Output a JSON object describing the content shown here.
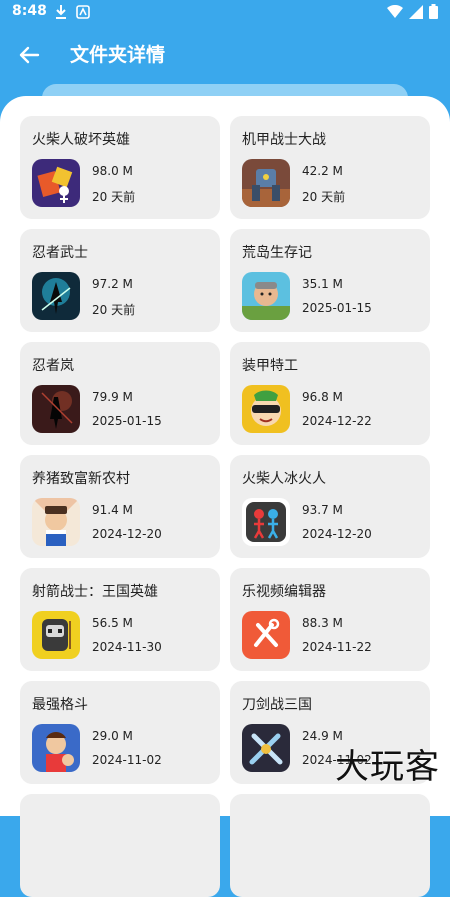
{
  "status_bar": {
    "time": "8:48"
  },
  "header": {
    "title": "文件夹详情"
  },
  "watermark": "大玩客",
  "apps": [
    {
      "name": "火柴人破坏英雄",
      "size": "98.0 M",
      "date": "20 天前",
      "icon": "stickman-destroy-hero-icon"
    },
    {
      "name": "机甲战士大战",
      "size": "42.2 M",
      "date": "20 天前",
      "icon": "mech-warrior-icon"
    },
    {
      "name": "忍者武士",
      "size": "97.2 M",
      "date": "20 天前",
      "icon": "ninja-samurai-icon"
    },
    {
      "name": "荒岛生存记",
      "size": "35.1 M",
      "date": "2025-01-15",
      "icon": "island-survival-icon"
    },
    {
      "name": "忍者岚",
      "size": "79.9 M",
      "date": "2025-01-15",
      "icon": "ninja-arashi-icon"
    },
    {
      "name": "装甲特工",
      "size": "96.8 M",
      "date": "2024-12-22",
      "icon": "armored-agent-icon"
    },
    {
      "name": "养猪致富新农村",
      "size": "91.4 M",
      "date": "2024-12-20",
      "icon": "pig-farm-icon"
    },
    {
      "name": "火柴人冰火人",
      "size": "93.7 M",
      "date": "2024-12-20",
      "icon": "stickman-fire-ice-icon"
    },
    {
      "name": "射箭战士：王国英雄",
      "size": "56.5 M",
      "date": "2024-11-30",
      "icon": "archer-kingdom-icon"
    },
    {
      "name": "乐视频编辑器",
      "size": "88.3 M",
      "date": "2024-11-22",
      "icon": "video-editor-icon"
    },
    {
      "name": "最强格斗",
      "size": "29.0 M",
      "date": "2024-11-02",
      "icon": "strongest-fight-icon"
    },
    {
      "name": "刀剑战三国",
      "size": "24.9 M",
      "date": "2024-11-02",
      "icon": "sword-three-kingdoms-icon"
    }
  ]
}
